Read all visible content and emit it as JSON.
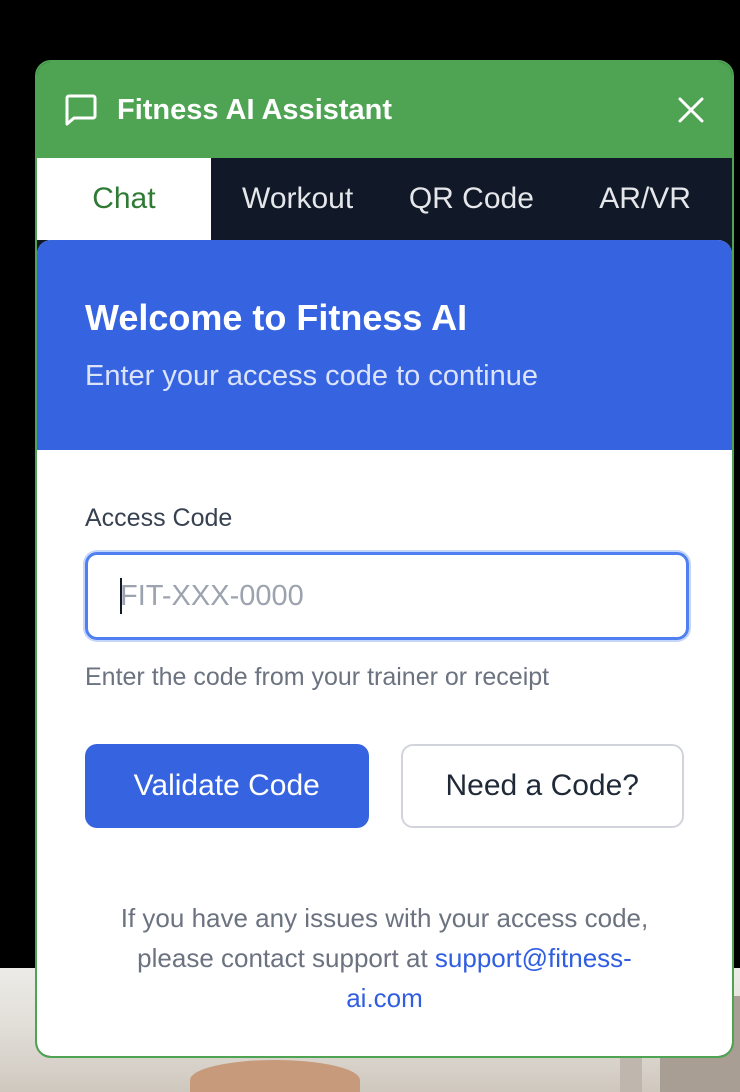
{
  "header": {
    "title": "Fitness AI Assistant",
    "chat_icon": "chat-bubble-icon",
    "close_icon": "close-icon"
  },
  "tabs": [
    {
      "label": "Chat",
      "active": true
    },
    {
      "label": "Workout",
      "active": false
    },
    {
      "label": "QR Code",
      "active": false
    },
    {
      "label": "AR/VR",
      "active": false
    }
  ],
  "welcome": {
    "title": "Welcome to Fitness AI",
    "subtitle": "Enter your access code to continue"
  },
  "form": {
    "label": "Access Code",
    "value": "",
    "placeholder": "FIT-XXX-0000",
    "hint": "Enter the code from your trainer or receipt"
  },
  "actions": {
    "validate_label": "Validate Code",
    "need_code_label": "Need a Code?"
  },
  "support": {
    "text": "If you have any issues with your access code, please contact support at ",
    "email_line1": "support@fitness-",
    "email_line2": "ai.com"
  },
  "colors": {
    "header_green": "#4fa453",
    "primary_blue": "#3663e0",
    "tab_bar_dark": "#111827"
  }
}
